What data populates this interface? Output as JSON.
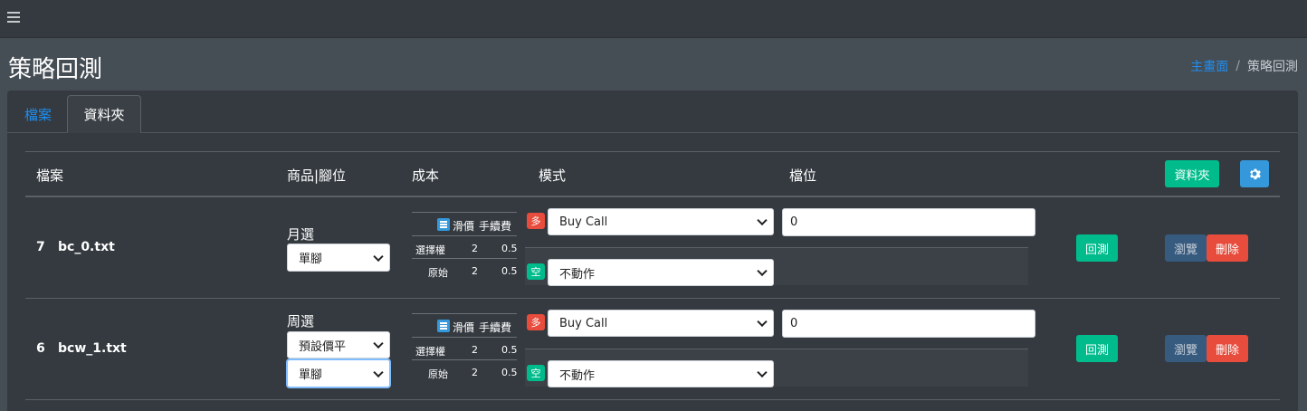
{
  "header": {
    "title": "策略回測"
  },
  "breadcrumb": {
    "home": "主畫面",
    "current": "策略回測"
  },
  "tabs": {
    "files": "檔案",
    "folder": "資料夾"
  },
  "table": {
    "col_file": "檔案",
    "col_product": "商品|腳位",
    "col_cost": "成本",
    "col_mode": "模式",
    "col_position": "檔位",
    "folder_button": "資料夾",
    "settings_icon": "gear-icon"
  },
  "cost_labels": {
    "slippage": "滑價",
    "fee": "手續費",
    "options": "選擇權",
    "original": "原始"
  },
  "rows": [
    {
      "num": "7",
      "file": "bc_0.txt",
      "product": "月選",
      "leg_select": "單腳",
      "options_slippage": "2",
      "options_fee": "0.5",
      "original_slippage": "2",
      "original_fee": "0.5",
      "long_badge": "多",
      "long_mode": "Buy Call",
      "short_badge": "空",
      "short_mode": "不動作",
      "position": "0",
      "backtest": "回測",
      "browse": "瀏覽",
      "delete": "刪除"
    },
    {
      "num": "6",
      "file": "bcw_1.txt",
      "product": "周選",
      "close_select": "預設價平",
      "leg_select": "單腳",
      "options_slippage": "2",
      "options_fee": "0.5",
      "original_slippage": "2",
      "original_fee": "0.5",
      "long_badge": "多",
      "long_mode": "Buy Call",
      "short_badge": "空",
      "short_mode": "不動作",
      "position": "0",
      "backtest": "回測",
      "browse": "瀏覽",
      "delete": "刪除"
    }
  ]
}
